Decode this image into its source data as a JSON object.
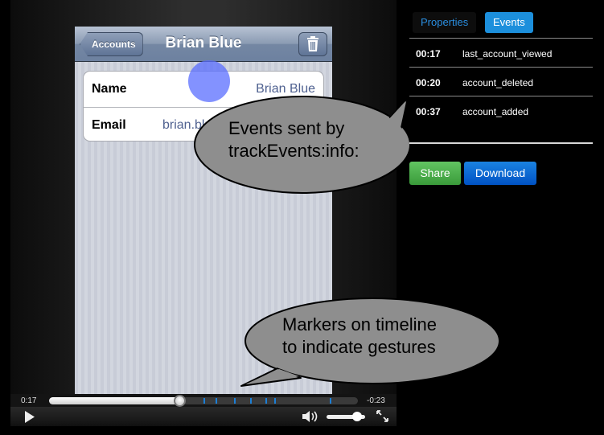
{
  "app": {
    "nav_back_label": "Accounts",
    "nav_title": "Brian Blue",
    "fields": [
      {
        "label": "Name",
        "value": "Brian Blue"
      },
      {
        "label": "Email",
        "value": "brian.blu"
      }
    ]
  },
  "annotations": {
    "events_callout": [
      "Events sent by",
      "trackEvents:info:"
    ],
    "markers_callout": [
      "Markers on timeline",
      "to indicate gestures"
    ]
  },
  "player": {
    "elapsed": "0:17",
    "remaining": "-0:23",
    "progress_fraction": 0.425,
    "marker_fractions": [
      0.5,
      0.54,
      0.6,
      0.65,
      0.7,
      0.73,
      0.91
    ],
    "volume_fraction": 0.8
  },
  "panel": {
    "tabs": [
      {
        "label": "Properties",
        "active": false
      },
      {
        "label": "Events",
        "active": true
      }
    ],
    "events": [
      {
        "time": "00:17",
        "name": "last_account_viewed"
      },
      {
        "time": "00:20",
        "name": "account_deleted"
      },
      {
        "time": "00:37",
        "name": "account_added"
      }
    ],
    "share_label": "Share",
    "download_label": "Download"
  },
  "colors": {
    "accent_blue": "#1c8fdc",
    "share_green": "#4cae4c",
    "marker_blue": "#1c7fd6",
    "touch_indicator": "#5a6eff"
  }
}
